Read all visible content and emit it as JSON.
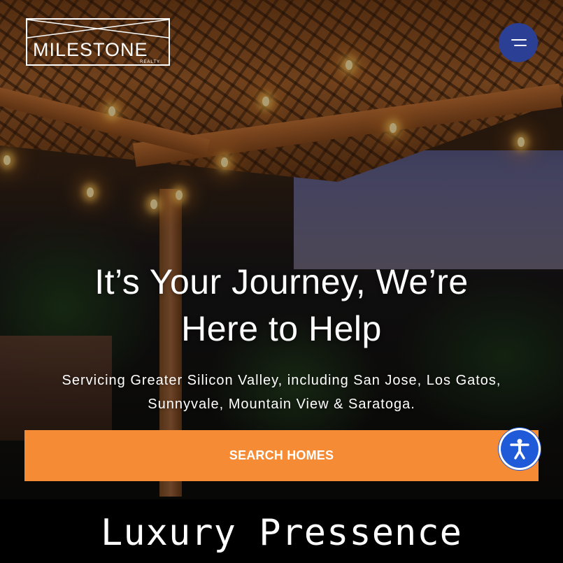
{
  "brand": {
    "logo_name": "MILESTONE",
    "logo_sub": "REALTY"
  },
  "header": {
    "menu_icon": "hamburger-menu-icon"
  },
  "hero": {
    "headline_line1": "It’s Your Journey, We’re",
    "headline_line2": "Here to Help",
    "subtext": "Servicing Greater Silicon Valley, including San Jose, Los Gatos, Sunnyvale, Mountain View & Saratoga.",
    "cta_label": "SEARCH HOMES"
  },
  "accessibility": {
    "icon": "accessibility-person-icon"
  },
  "caption": {
    "text": "Luxury Pressence"
  },
  "colors": {
    "cta": "#f58b35",
    "menu_button": "#2b3f94",
    "accessibility_button": "#1f5ad8",
    "banner": "#000000"
  }
}
